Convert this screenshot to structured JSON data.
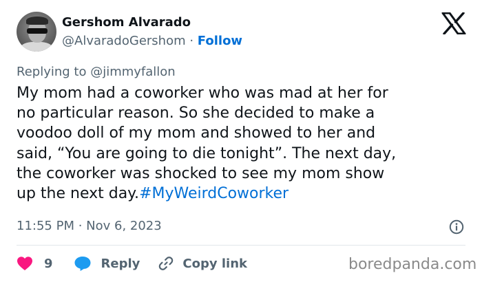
{
  "author": {
    "name": "Gershom Alvarado",
    "handle": "@AlvaradoGershom",
    "separator": " · ",
    "follow_label": "Follow"
  },
  "icons": {
    "brand": "x-logo-icon",
    "info": "info-icon",
    "like": "heart-icon",
    "reply": "reply-bubble-icon",
    "copy": "link-icon"
  },
  "replying_to": "Replying to @jimmyfallon",
  "tweet": {
    "lines": [
      "My mom had a coworker who was mad at her for",
      "no particular reason. So she decided to make a",
      "voodoo doll of my mom and showed to her and",
      "said, “You are going to die tonight”. The next day,",
      "the coworker was shocked to see my mom show"
    ],
    "last_line": "up the next day.",
    "hashtag": "#MyWeirdCoworker"
  },
  "timestamp": "11:55 PM · Nov 6, 2023",
  "actions": {
    "like_count": "9",
    "reply_label": "Reply",
    "copy_label": "Copy link"
  },
  "watermark": "boredpanda.com",
  "colors": {
    "link": "#006fd6",
    "like": "#f91880",
    "reply": "#1d9bf0",
    "muted": "#536471",
    "text": "#0f1419"
  }
}
